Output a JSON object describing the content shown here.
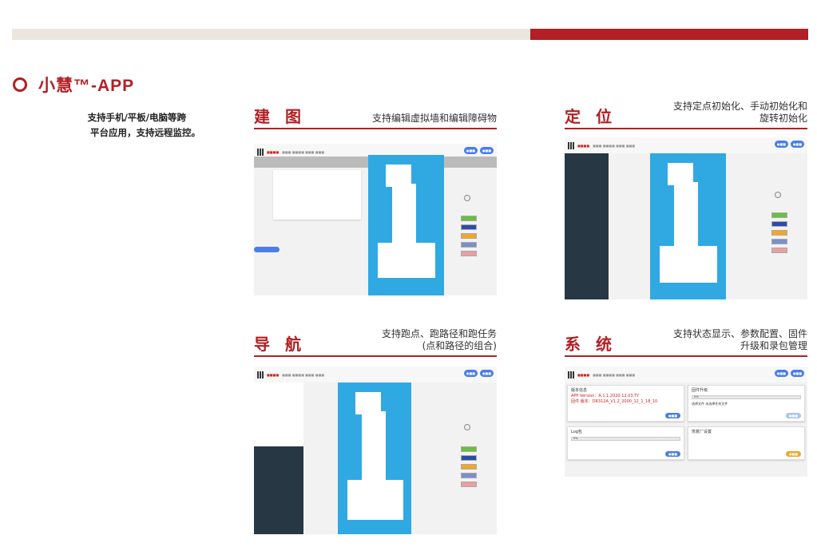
{
  "brand": {
    "title": "小慧™-APP"
  },
  "description": [
    "支持手机/平板/电脑等跨",
    "平台应用，支持远程监控。"
  ],
  "sections": {
    "mapping": {
      "title": "建 图",
      "subtitle": "支持编辑虚拟墙和编辑障碍物"
    },
    "locating": {
      "title": "定 位",
      "subtitle_line1": "支持定点初始化、手动初始化和",
      "subtitle_line2": "旋转初始化"
    },
    "navigation": {
      "title": "导 航",
      "subtitle_line1": "支持跑点、跑路径和跑任务",
      "subtitle_line2": "(点和路径的组合)"
    },
    "system": {
      "title": "系 统",
      "subtitle_line1": "支持状态显示、参数配置、固件",
      "subtitle_line2": "升级和录包管理"
    }
  },
  "system_screen": {
    "version_card_title": "版本信息",
    "app_version": "APP Version：A.1.1.2020.12.03.TY",
    "firmware_version": "固件 版本：DR312A_V1.2_2000_12_1_18_10",
    "firmware_card_title": "固件升级",
    "firmware_progress": "0%",
    "firmware_file_label": "选择文件 未选择任何文件",
    "log_card_title": "Log包",
    "log_progress": "0%",
    "factory_card_title": "恢复厂设置"
  },
  "colors": {
    "accent": "#b21f24",
    "map_blue": "#30a9e3",
    "panel_dark": "#283744"
  }
}
